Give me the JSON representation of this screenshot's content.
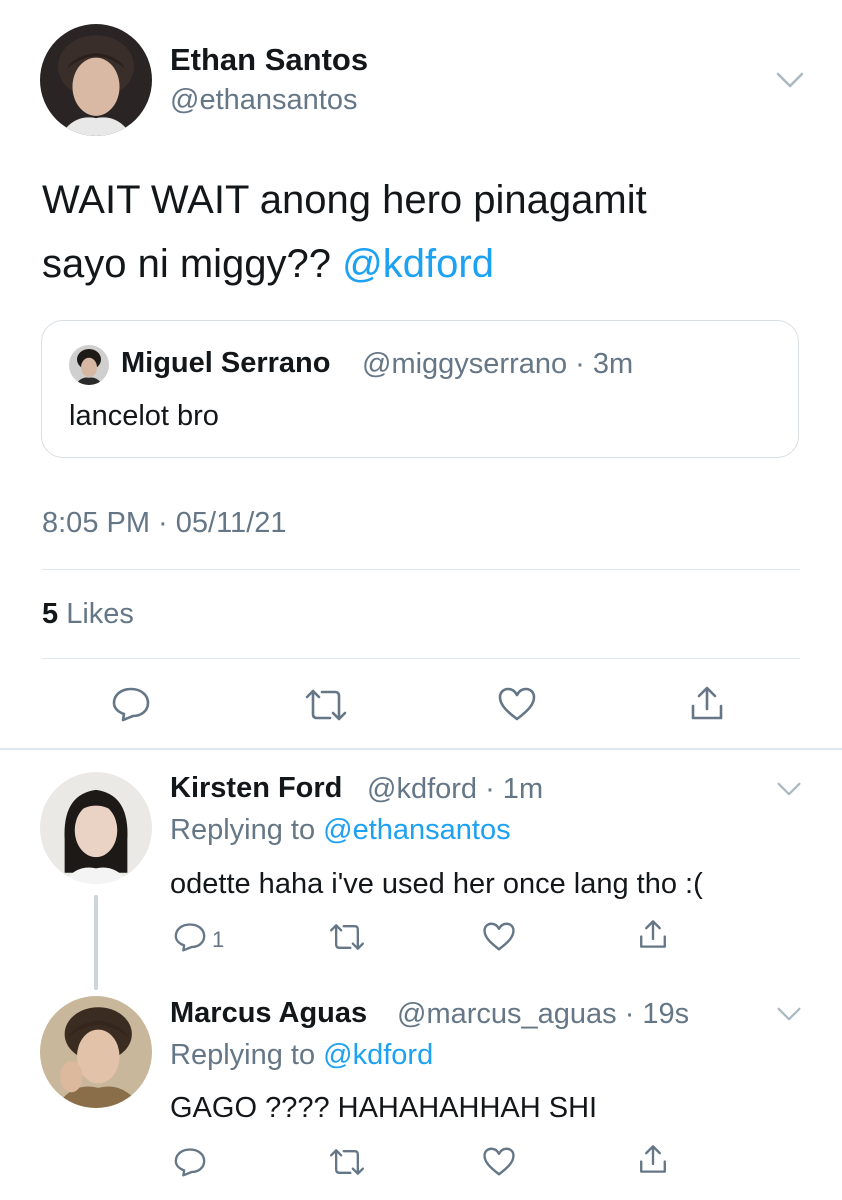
{
  "main_tweet": {
    "author_name": "Ethan Santos",
    "author_handle": "@ethansantos",
    "text_part1": "WAIT WAIT anong hero pinagamit",
    "text_part2": "sayo ni miggy?? ",
    "mention": "@kdford",
    "quoted": {
      "author_name": "Miguel Serrano",
      "meta": "@miggyserrano · 3m",
      "text": "lancelot bro"
    },
    "timestamp": "8:05 PM · 05/11/21",
    "likes_count": "5",
    "likes_label": "Likes"
  },
  "replies": [
    {
      "author_name": "Kirsten Ford",
      "meta": "@kdford · 1m",
      "replying_prefix": "Replying to ",
      "replying_to": "@ethansantos",
      "text": "odette haha i've used her once lang tho :(",
      "reply_count": "1"
    },
    {
      "author_name": "Marcus Aguas",
      "meta": "@marcus_aguas · 19s",
      "replying_prefix": "Replying to ",
      "replying_to": "@kdford",
      "text": "GAGO ???? HAHAHAHHAH SHI",
      "reply_count": ""
    }
  ],
  "icons": [
    "chevron-down-icon",
    "reply-icon",
    "retweet-icon",
    "like-icon",
    "share-icon"
  ],
  "colors": {
    "accent": "#1da1f2",
    "secondary_text": "#657786",
    "divider": "#e1e8ed"
  }
}
